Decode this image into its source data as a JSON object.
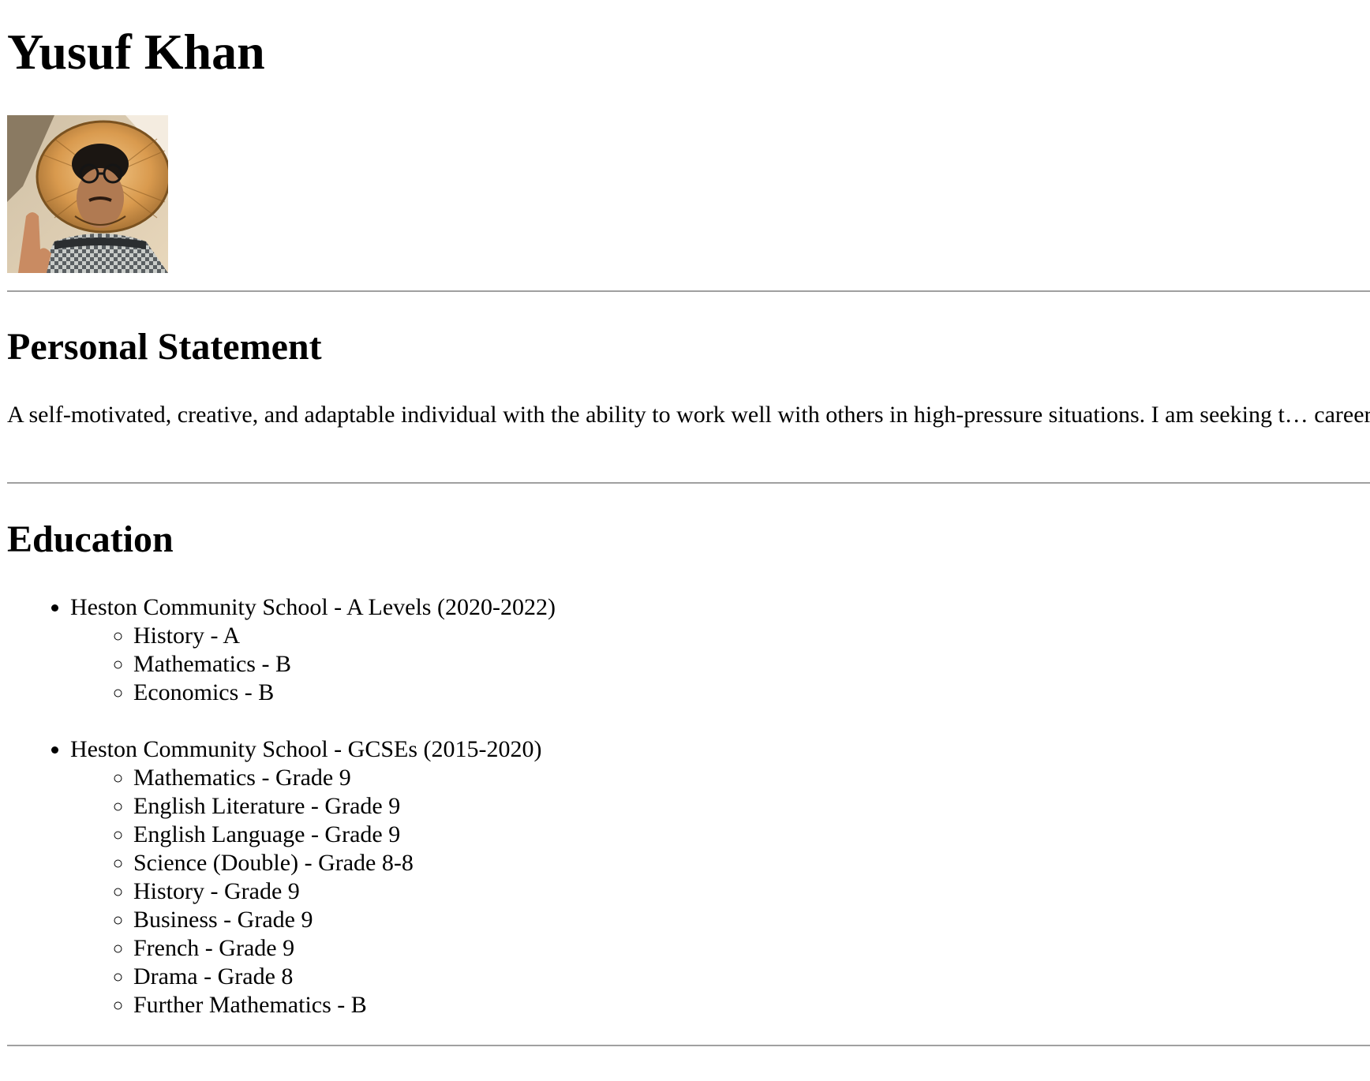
{
  "name": "Yusuf Khan",
  "photo_alt": "Yusuf Khan",
  "sections": {
    "personal_statement": {
      "heading": "Personal Statement",
      "text": "A self-motivated, creative, and adaptable individual with the ability to work well with others in high-pressure situations. I am seeking t… career."
    },
    "education": {
      "heading": "Education",
      "entries": [
        {
          "title": "Heston Community School - A Levels (2020-2022)",
          "items": [
            "History - A",
            "Mathematics - B",
            "Economics - B"
          ]
        },
        {
          "title": "Heston Community School - GCSEs (2015-2020)",
          "items": [
            "Mathematics - Grade 9",
            "English Literature - Grade 9",
            "English Language - Grade 9",
            "Science (Double) - Grade 8-8",
            "History - Grade 9",
            "Business - Grade 9",
            "French - Grade 9",
            "Drama - Grade 8",
            "Further Mathematics - B"
          ]
        }
      ]
    }
  }
}
